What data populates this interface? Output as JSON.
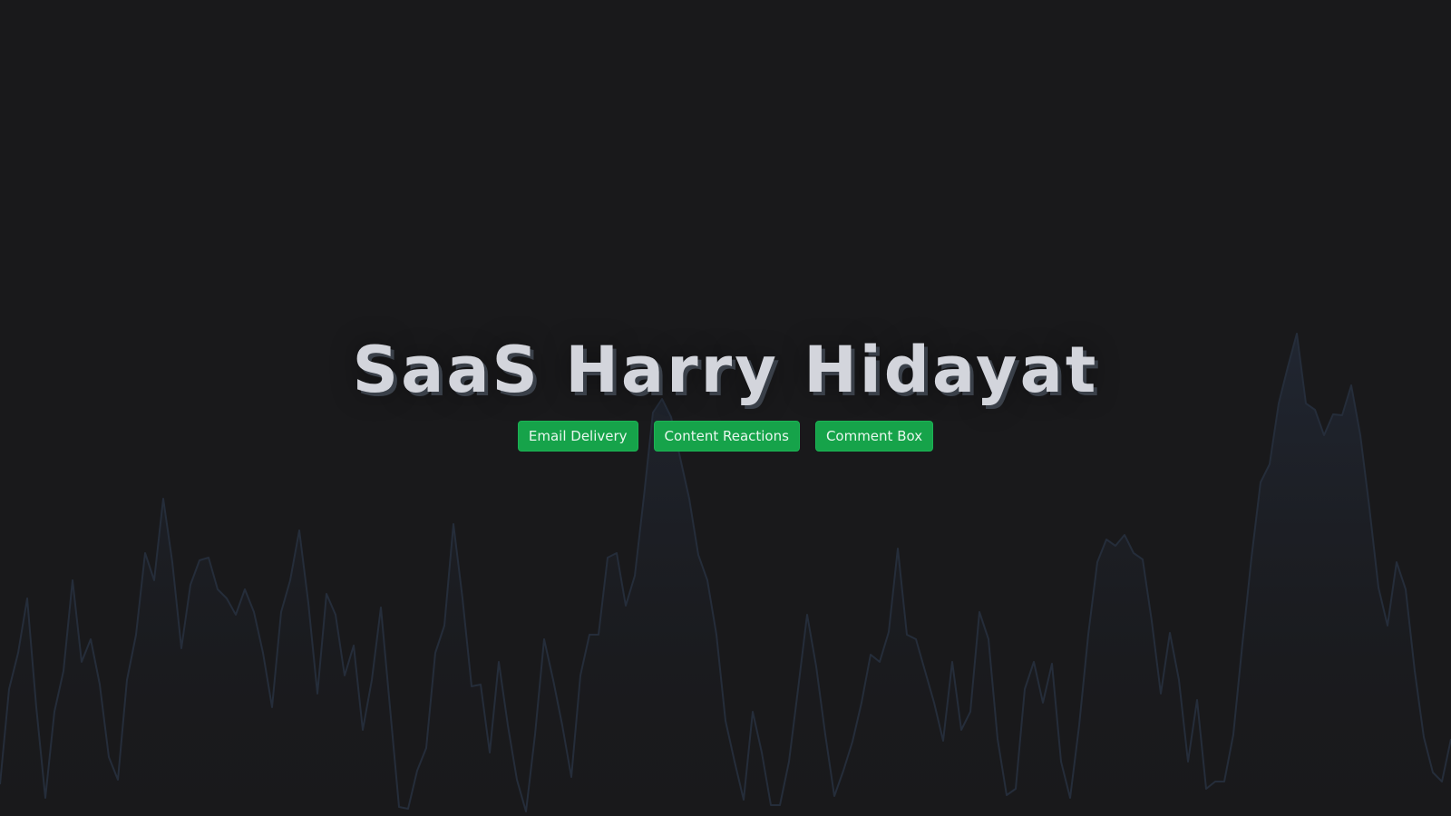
{
  "hero": {
    "title": "SaaS Harry Hidayat",
    "buttons": [
      {
        "label": "Email Delivery"
      },
      {
        "label": "Content Reactions"
      },
      {
        "label": "Comment Box"
      }
    ]
  },
  "colors": {
    "background": "#19191b",
    "title_text": "#d3d5dc",
    "title_shadow": "#3a4049",
    "button": "#16a34a",
    "wave_stroke": "#252d3a",
    "wave_fill": "#1f2530"
  }
}
